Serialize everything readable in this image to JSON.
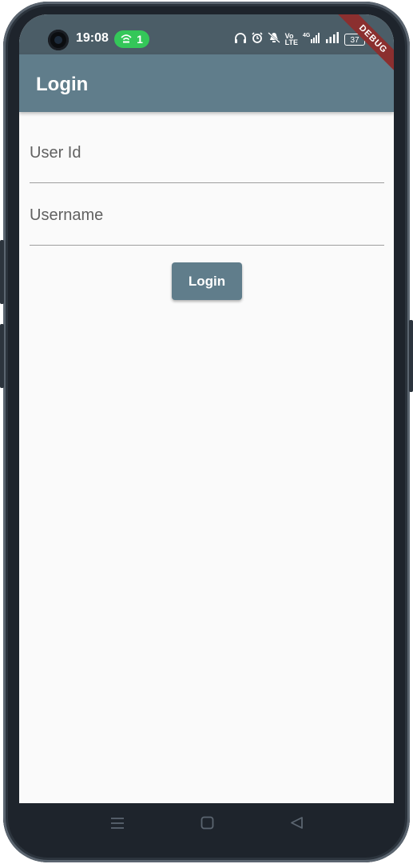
{
  "status_bar": {
    "time": "19:08",
    "hotspot_count": "1",
    "battery": "37",
    "icons": [
      "headphones-icon",
      "alarm-icon",
      "mute-icon",
      "volte-icon",
      "4g-signal-icon",
      "signal-icon",
      "battery-icon"
    ]
  },
  "app_bar": {
    "title": "Login",
    "debug_banner": "DEBUG"
  },
  "form": {
    "user_id_label": "User Id",
    "username_label": "Username",
    "login_button": "Login"
  },
  "nav_bar": {
    "icons": [
      "menu-icon",
      "home-icon",
      "back-icon"
    ]
  },
  "colors": {
    "primary": "#607d8b",
    "status_bar": "#4b5d67",
    "background": "#fafafa",
    "hotspot": "#34c759",
    "debug": "#8b2f2f"
  }
}
